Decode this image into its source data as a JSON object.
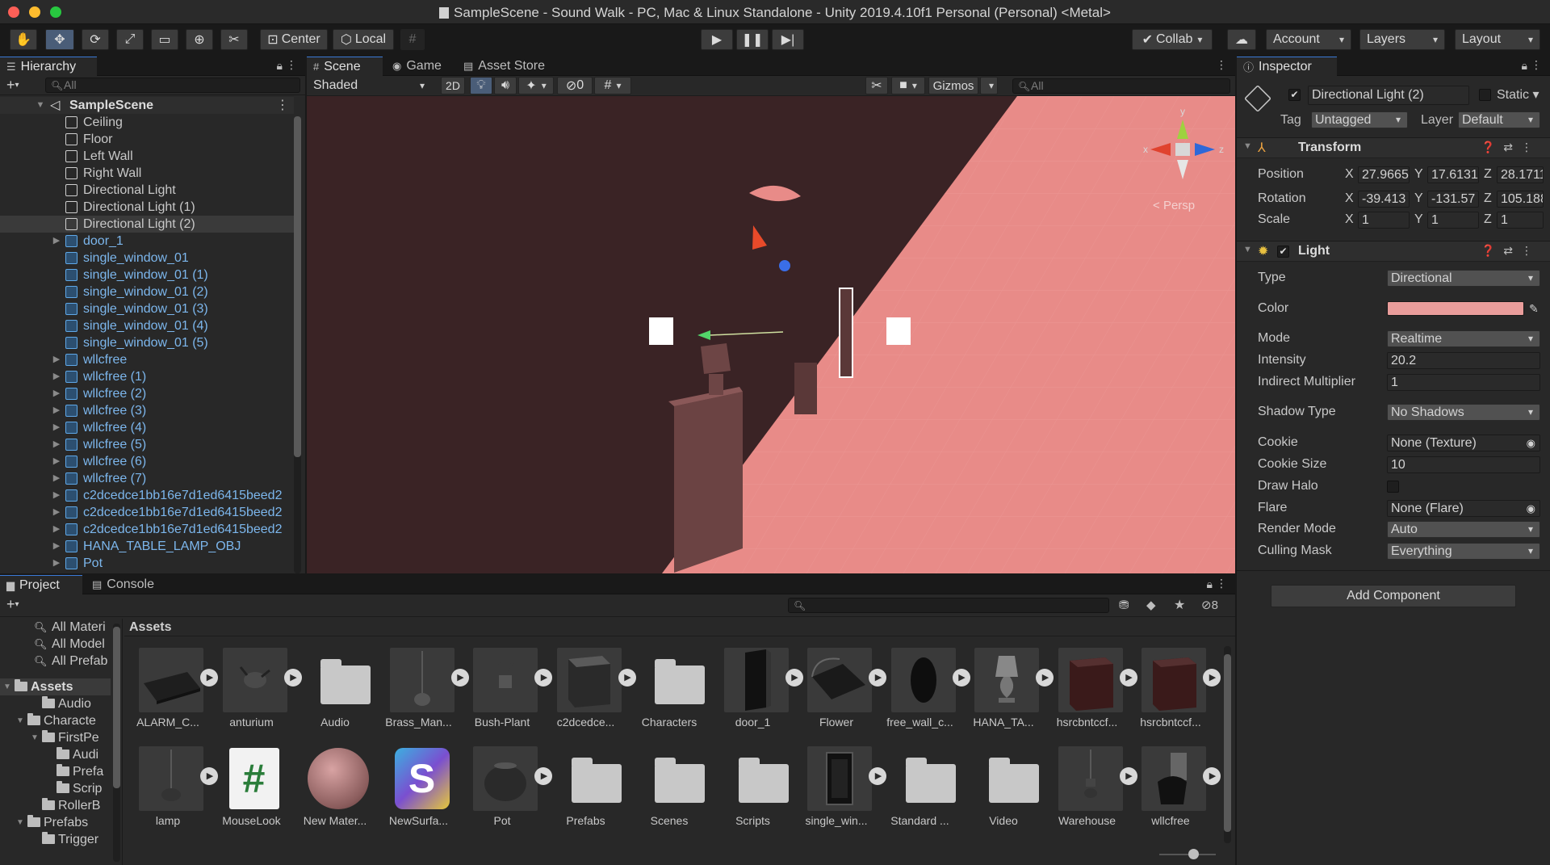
{
  "window": {
    "title": "SampleScene - Sound Walk - PC, Mac & Linux Standalone - Unity 2019.4.10f1 Personal (Personal) <Metal>"
  },
  "toolbar": {
    "center_label": "Center",
    "local_label": "Local",
    "collab_label": "Collab",
    "account_label": "Account",
    "layers_label": "Layers",
    "layout_label": "Layout"
  },
  "hierarchy": {
    "tab_label": "Hierarchy",
    "search_placeholder": "All",
    "scene_name": "SampleScene",
    "items": [
      {
        "label": "Ceiling",
        "prefab": false,
        "expandable": false
      },
      {
        "label": "Floor",
        "prefab": false,
        "expandable": false
      },
      {
        "label": "Left Wall",
        "prefab": false,
        "expandable": false
      },
      {
        "label": "Right Wall",
        "prefab": false,
        "expandable": false
      },
      {
        "label": "Directional Light",
        "prefab": false,
        "expandable": false
      },
      {
        "label": "Directional Light (1)",
        "prefab": false,
        "expandable": false
      },
      {
        "label": "Directional Light (2)",
        "prefab": false,
        "expandable": false,
        "selected": true
      },
      {
        "label": "door_1",
        "prefab": true,
        "expandable": true
      },
      {
        "label": "single_window_01",
        "prefab": true,
        "expandable": false
      },
      {
        "label": "single_window_01 (1)",
        "prefab": true,
        "expandable": false
      },
      {
        "label": "single_window_01 (2)",
        "prefab": true,
        "expandable": false
      },
      {
        "label": "single_window_01 (3)",
        "prefab": true,
        "expandable": false
      },
      {
        "label": "single_window_01 (4)",
        "prefab": true,
        "expandable": false
      },
      {
        "label": "single_window_01 (5)",
        "prefab": true,
        "expandable": false
      },
      {
        "label": "wllcfree",
        "prefab": true,
        "expandable": true
      },
      {
        "label": "wllcfree (1)",
        "prefab": true,
        "expandable": true
      },
      {
        "label": "wllcfree (2)",
        "prefab": true,
        "expandable": true
      },
      {
        "label": "wllcfree (3)",
        "prefab": true,
        "expandable": true
      },
      {
        "label": "wllcfree (4)",
        "prefab": true,
        "expandable": true
      },
      {
        "label": "wllcfree (5)",
        "prefab": true,
        "expandable": true
      },
      {
        "label": "wllcfree (6)",
        "prefab": true,
        "expandable": true
      },
      {
        "label": "wllcfree (7)",
        "prefab": true,
        "expandable": true
      },
      {
        "label": "c2dcedce1bb16e7d1ed6415beed2",
        "prefab": true,
        "expandable": true
      },
      {
        "label": "c2dcedce1bb16e7d1ed6415beed2",
        "prefab": true,
        "expandable": true
      },
      {
        "label": "c2dcedce1bb16e7d1ed6415beed2",
        "prefab": true,
        "expandable": true
      },
      {
        "label": "HANA_TABLE_LAMP_OBJ",
        "prefab": true,
        "expandable": true
      },
      {
        "label": "Pot",
        "prefab": true,
        "expandable": true
      }
    ]
  },
  "scene": {
    "tabs": [
      {
        "label": "Scene",
        "icon": "hash-icon"
      },
      {
        "label": "Game",
        "icon": "gamepad-icon"
      },
      {
        "label": "Asset Store",
        "icon": "bag-icon"
      }
    ],
    "shading_mode": "Shaded",
    "mode_2d": "2D",
    "hidden_count": "0",
    "gizmos_label": "Gizmos",
    "search_placeholder": "All",
    "persp_label": "Persp",
    "bg_color": "#3a2325",
    "light_color": "#e88b88"
  },
  "inspector": {
    "tab_label": "Inspector",
    "object_name": "Directional Light (2)",
    "static_label": "Static",
    "tag_label": "Tag",
    "tag_value": "Untagged",
    "layer_label": "Layer",
    "layer_value": "Default",
    "transform": {
      "title": "Transform",
      "position_label": "Position",
      "rotation_label": "Rotation",
      "scale_label": "Scale",
      "position": {
        "x": "27.9665",
        "y": "17.6131",
        "z": "28.1711"
      },
      "rotation": {
        "x": "-39.413",
        "y": "-131.57",
        "z": "105.188"
      },
      "scale": {
        "x": "1",
        "y": "1",
        "z": "1"
      }
    },
    "light": {
      "title": "Light",
      "type_label": "Type",
      "type_value": "Directional",
      "color_label": "Color",
      "color_value": "#e99d9b",
      "mode_label": "Mode",
      "mode_value": "Realtime",
      "intensity_label": "Intensity",
      "intensity_value": "20.2",
      "indirect_label": "Indirect Multiplier",
      "indirect_value": "1",
      "shadow_label": "Shadow Type",
      "shadow_value": "No Shadows",
      "cookie_label": "Cookie",
      "cookie_value": "None (Texture)",
      "cookie_size_label": "Cookie Size",
      "cookie_size_value": "10",
      "draw_halo_label": "Draw Halo",
      "flare_label": "Flare",
      "flare_value": "None (Flare)",
      "render_mode_label": "Render Mode",
      "render_mode_value": "Auto",
      "culling_label": "Culling Mask",
      "culling_value": "Everything"
    },
    "add_component_label": "Add Component"
  },
  "project": {
    "tabs": [
      {
        "label": "Project",
        "icon": "folder-icon"
      },
      {
        "label": "Console",
        "icon": "console-icon"
      }
    ],
    "hidden_count": "8",
    "tree": [
      {
        "label": "All Materi",
        "indent": 1,
        "kind": "search"
      },
      {
        "label": "All Model",
        "indent": 1,
        "kind": "search"
      },
      {
        "label": "All Prefab",
        "indent": 1,
        "kind": "search"
      },
      {
        "label": "Assets",
        "indent": 0,
        "kind": "folder",
        "bold": true
      },
      {
        "label": "Audio",
        "indent": 2,
        "kind": "folder"
      },
      {
        "label": "Characte",
        "indent": 1,
        "kind": "folder"
      },
      {
        "label": "FirstPe",
        "indent": 2,
        "kind": "folder"
      },
      {
        "label": "Audi",
        "indent": 3,
        "kind": "folder"
      },
      {
        "label": "Prefa",
        "indent": 3,
        "kind": "folder"
      },
      {
        "label": "Scrip",
        "indent": 3,
        "kind": "folder"
      },
      {
        "label": "RollerB",
        "indent": 2,
        "kind": "folder"
      },
      {
        "label": "Prefabs",
        "indent": 1,
        "kind": "folder"
      },
      {
        "label": "Trigger",
        "indent": 2,
        "kind": "folder"
      }
    ],
    "breadcrumb": "Assets",
    "assets_row1": [
      {
        "name": "ALARM_C...",
        "kind": "model",
        "play": true
      },
      {
        "name": "anturium",
        "kind": "model",
        "play": true
      },
      {
        "name": "Audio",
        "kind": "folder",
        "play": false
      },
      {
        "name": "Brass_Man...",
        "kind": "model",
        "play": true
      },
      {
        "name": "Bush-Plant",
        "kind": "model",
        "play": true
      },
      {
        "name": "c2dcedce...",
        "kind": "model",
        "play": true
      },
      {
        "name": "Characters",
        "kind": "folder",
        "play": false
      },
      {
        "name": "door_1",
        "kind": "model",
        "play": true
      },
      {
        "name": "Flower",
        "kind": "model",
        "play": true
      },
      {
        "name": "free_wall_c...",
        "kind": "model",
        "play": true
      },
      {
        "name": "HANA_TA...",
        "kind": "model",
        "play": true
      },
      {
        "name": "hsrcbntccf...",
        "kind": "model",
        "play": true
      },
      {
        "name": "hsrcbntccf...",
        "kind": "model",
        "play": true
      }
    ],
    "assets_row2": [
      {
        "name": "lamp",
        "kind": "model",
        "play": true
      },
      {
        "name": "MouseLook",
        "kind": "script",
        "play": false
      },
      {
        "name": "New Mater...",
        "kind": "material",
        "play": false
      },
      {
        "name": "NewSurfa...",
        "kind": "surface",
        "play": false
      },
      {
        "name": "Pot",
        "kind": "model",
        "play": true
      },
      {
        "name": "Prefabs",
        "kind": "folder",
        "play": false
      },
      {
        "name": "Scenes",
        "kind": "folder",
        "play": false
      },
      {
        "name": "Scripts",
        "kind": "folder",
        "play": false
      },
      {
        "name": "single_win...",
        "kind": "model",
        "play": true
      },
      {
        "name": "Standard ...",
        "kind": "folder",
        "play": false
      },
      {
        "name": "Video",
        "kind": "folder",
        "play": false
      },
      {
        "name": "Warehouse",
        "kind": "model",
        "play": true
      },
      {
        "name": "wllcfree",
        "kind": "model",
        "play": true
      }
    ]
  }
}
